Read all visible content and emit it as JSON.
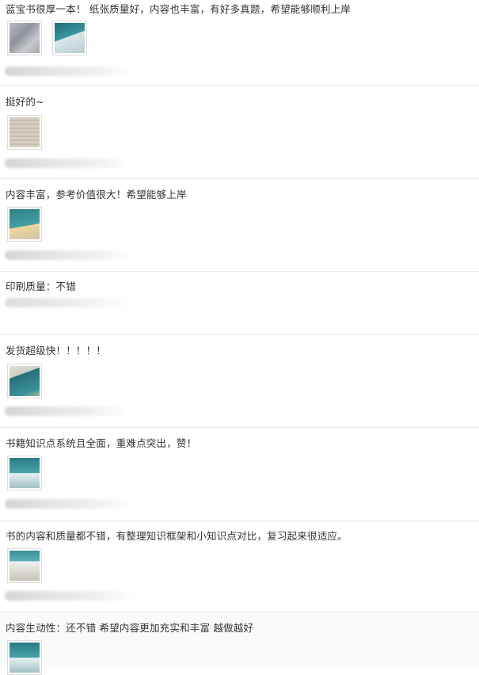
{
  "reviews": [
    {
      "text": "蓝宝书很厚一本！ 纸张质量好，内容也丰富，有好多真题，希望能够顺利上岸",
      "images": [
        "photo",
        "photo"
      ]
    },
    {
      "text": "挺好的~",
      "images": [
        "photo"
      ]
    },
    {
      "text": "内容丰富，参考价值很大！希望能够上岸",
      "images": [
        "photo"
      ]
    },
    {
      "text": "印刷质量：不错",
      "images": []
    },
    {
      "text": "发货超级快！！！！！",
      "images": [
        "photo"
      ]
    },
    {
      "text": "书籍知识点系统且全面，重难点突出，赞！",
      "images": [
        "photo"
      ]
    },
    {
      "text": "书的内容和质量都不错，有整理知识框架和小知识点对比，复习起来很适应。",
      "images": [
        "photo"
      ]
    },
    {
      "text": "内容生动性：还不错 希望内容更加充实和丰富 越做越好",
      "images": [
        "photo"
      ]
    }
  ],
  "colors": {
    "text": "#333333",
    "divider": "#e9e9e9",
    "thumb_accent": "#2f7e86"
  }
}
